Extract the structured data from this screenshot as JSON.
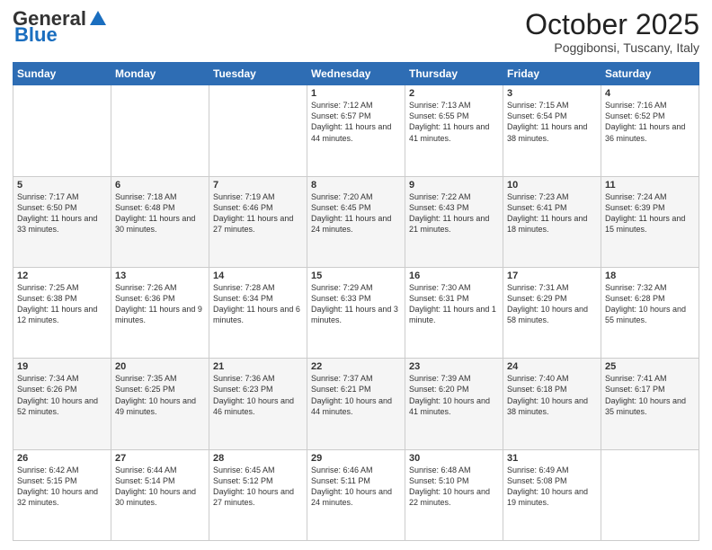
{
  "logo": {
    "general": "General",
    "blue": "Blue"
  },
  "header": {
    "month": "October 2025",
    "location": "Poggibonsi, Tuscany, Italy"
  },
  "days_of_week": [
    "Sunday",
    "Monday",
    "Tuesday",
    "Wednesday",
    "Thursday",
    "Friday",
    "Saturday"
  ],
  "weeks": [
    [
      {
        "day": "",
        "info": ""
      },
      {
        "day": "",
        "info": ""
      },
      {
        "day": "",
        "info": ""
      },
      {
        "day": "1",
        "info": "Sunrise: 7:12 AM\nSunset: 6:57 PM\nDaylight: 11 hours and 44 minutes."
      },
      {
        "day": "2",
        "info": "Sunrise: 7:13 AM\nSunset: 6:55 PM\nDaylight: 11 hours and 41 minutes."
      },
      {
        "day": "3",
        "info": "Sunrise: 7:15 AM\nSunset: 6:54 PM\nDaylight: 11 hours and 38 minutes."
      },
      {
        "day": "4",
        "info": "Sunrise: 7:16 AM\nSunset: 6:52 PM\nDaylight: 11 hours and 36 minutes."
      }
    ],
    [
      {
        "day": "5",
        "info": "Sunrise: 7:17 AM\nSunset: 6:50 PM\nDaylight: 11 hours and 33 minutes."
      },
      {
        "day": "6",
        "info": "Sunrise: 7:18 AM\nSunset: 6:48 PM\nDaylight: 11 hours and 30 minutes."
      },
      {
        "day": "7",
        "info": "Sunrise: 7:19 AM\nSunset: 6:46 PM\nDaylight: 11 hours and 27 minutes."
      },
      {
        "day": "8",
        "info": "Sunrise: 7:20 AM\nSunset: 6:45 PM\nDaylight: 11 hours and 24 minutes."
      },
      {
        "day": "9",
        "info": "Sunrise: 7:22 AM\nSunset: 6:43 PM\nDaylight: 11 hours and 21 minutes."
      },
      {
        "day": "10",
        "info": "Sunrise: 7:23 AM\nSunset: 6:41 PM\nDaylight: 11 hours and 18 minutes."
      },
      {
        "day": "11",
        "info": "Sunrise: 7:24 AM\nSunset: 6:39 PM\nDaylight: 11 hours and 15 minutes."
      }
    ],
    [
      {
        "day": "12",
        "info": "Sunrise: 7:25 AM\nSunset: 6:38 PM\nDaylight: 11 hours and 12 minutes."
      },
      {
        "day": "13",
        "info": "Sunrise: 7:26 AM\nSunset: 6:36 PM\nDaylight: 11 hours and 9 minutes."
      },
      {
        "day": "14",
        "info": "Sunrise: 7:28 AM\nSunset: 6:34 PM\nDaylight: 11 hours and 6 minutes."
      },
      {
        "day": "15",
        "info": "Sunrise: 7:29 AM\nSunset: 6:33 PM\nDaylight: 11 hours and 3 minutes."
      },
      {
        "day": "16",
        "info": "Sunrise: 7:30 AM\nSunset: 6:31 PM\nDaylight: 11 hours and 1 minute."
      },
      {
        "day": "17",
        "info": "Sunrise: 7:31 AM\nSunset: 6:29 PM\nDaylight: 10 hours and 58 minutes."
      },
      {
        "day": "18",
        "info": "Sunrise: 7:32 AM\nSunset: 6:28 PM\nDaylight: 10 hours and 55 minutes."
      }
    ],
    [
      {
        "day": "19",
        "info": "Sunrise: 7:34 AM\nSunset: 6:26 PM\nDaylight: 10 hours and 52 minutes."
      },
      {
        "day": "20",
        "info": "Sunrise: 7:35 AM\nSunset: 6:25 PM\nDaylight: 10 hours and 49 minutes."
      },
      {
        "day": "21",
        "info": "Sunrise: 7:36 AM\nSunset: 6:23 PM\nDaylight: 10 hours and 46 minutes."
      },
      {
        "day": "22",
        "info": "Sunrise: 7:37 AM\nSunset: 6:21 PM\nDaylight: 10 hours and 44 minutes."
      },
      {
        "day": "23",
        "info": "Sunrise: 7:39 AM\nSunset: 6:20 PM\nDaylight: 10 hours and 41 minutes."
      },
      {
        "day": "24",
        "info": "Sunrise: 7:40 AM\nSunset: 6:18 PM\nDaylight: 10 hours and 38 minutes."
      },
      {
        "day": "25",
        "info": "Sunrise: 7:41 AM\nSunset: 6:17 PM\nDaylight: 10 hours and 35 minutes."
      }
    ],
    [
      {
        "day": "26",
        "info": "Sunrise: 6:42 AM\nSunset: 5:15 PM\nDaylight: 10 hours and 32 minutes."
      },
      {
        "day": "27",
        "info": "Sunrise: 6:44 AM\nSunset: 5:14 PM\nDaylight: 10 hours and 30 minutes."
      },
      {
        "day": "28",
        "info": "Sunrise: 6:45 AM\nSunset: 5:12 PM\nDaylight: 10 hours and 27 minutes."
      },
      {
        "day": "29",
        "info": "Sunrise: 6:46 AM\nSunset: 5:11 PM\nDaylight: 10 hours and 24 minutes."
      },
      {
        "day": "30",
        "info": "Sunrise: 6:48 AM\nSunset: 5:10 PM\nDaylight: 10 hours and 22 minutes."
      },
      {
        "day": "31",
        "info": "Sunrise: 6:49 AM\nSunset: 5:08 PM\nDaylight: 10 hours and 19 minutes."
      },
      {
        "day": "",
        "info": ""
      }
    ]
  ]
}
